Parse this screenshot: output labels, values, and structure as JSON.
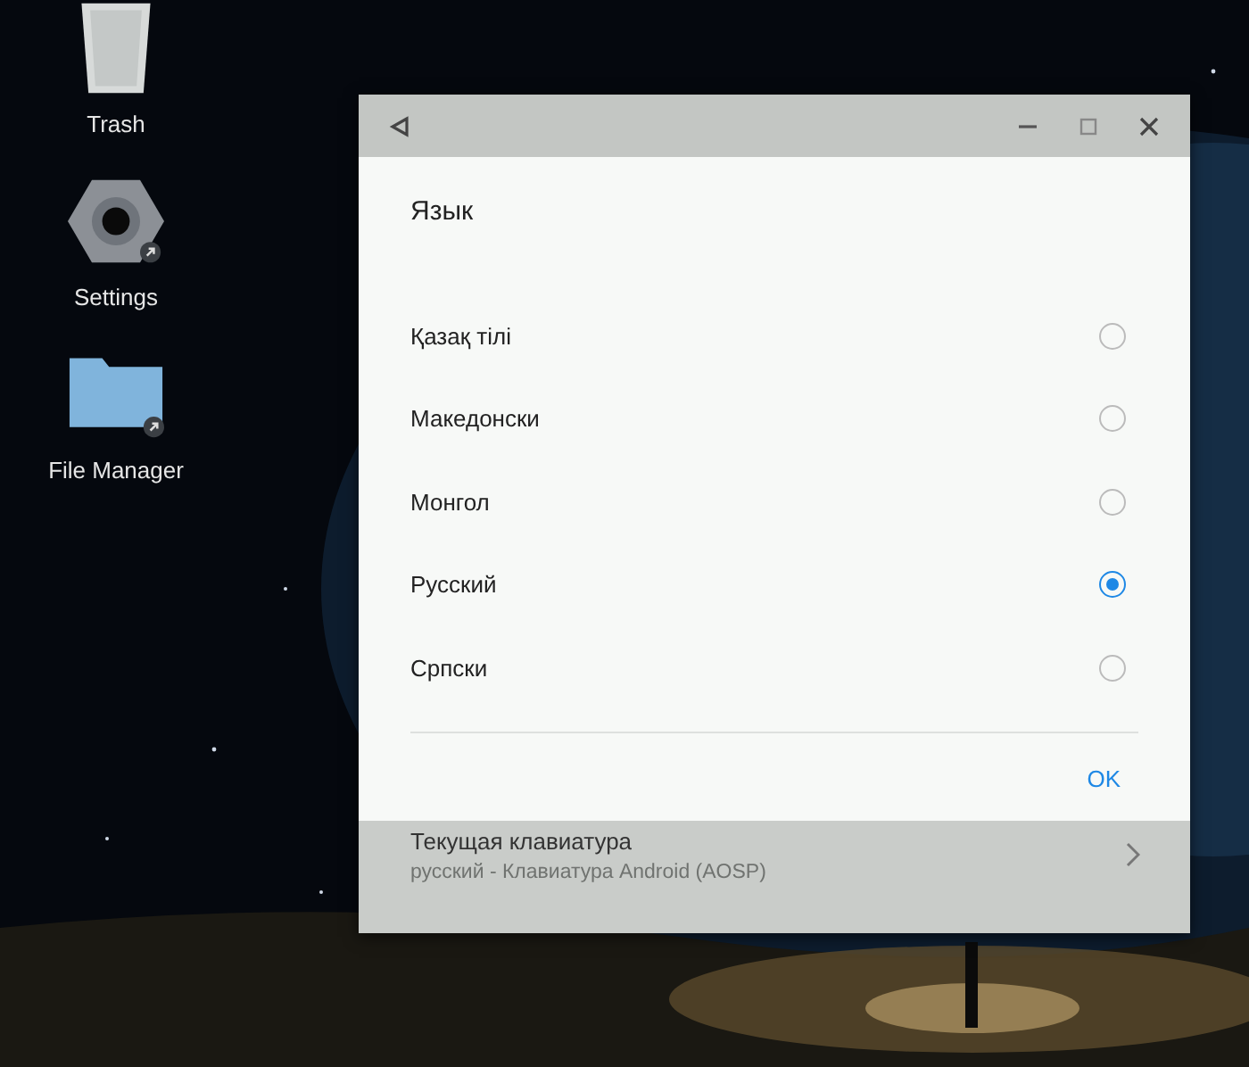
{
  "desktop_icons": [
    {
      "label": "Trash",
      "kind": "trash"
    },
    {
      "label": "Settings",
      "kind": "settings"
    },
    {
      "label": "File Manager",
      "kind": "folder"
    }
  ],
  "window": {
    "controls": [
      {
        "kind": "back"
      },
      {
        "kind": "minimize"
      },
      {
        "kind": "maximize"
      },
      {
        "kind": "close"
      }
    ]
  },
  "settings_row": {
    "title": "Текущая клавиатура",
    "subtitle": "русский - Клавиатура Android (AOSP)"
  },
  "dialog": {
    "title": "Язык",
    "options": [
      {
        "label": "Қазақ тілі",
        "selected": false
      },
      {
        "label": "Македонски",
        "selected": false
      },
      {
        "label": "Монгол",
        "selected": false
      },
      {
        "label": "Русский",
        "selected": true
      },
      {
        "label": "Српски",
        "selected": false
      }
    ],
    "button": "OK"
  }
}
